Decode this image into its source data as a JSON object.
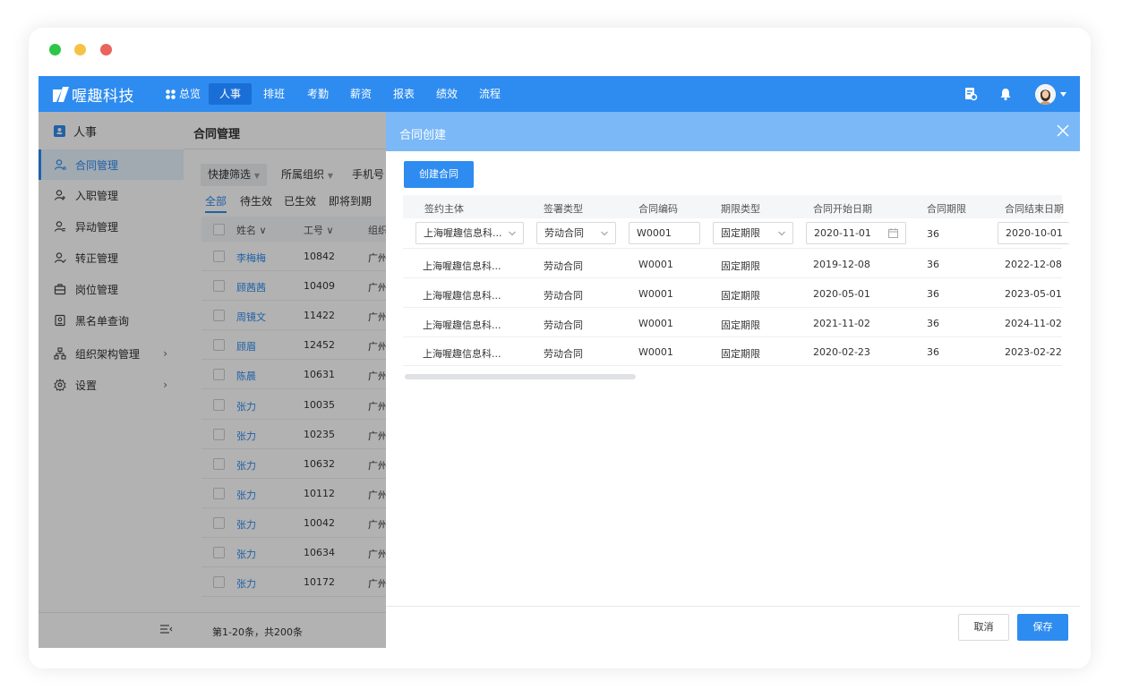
{
  "app": {
    "brand": "喔趣科技",
    "nav": [
      "总览",
      "人事",
      "排班",
      "考勤",
      "薪资",
      "报表",
      "绩效",
      "流程"
    ],
    "active_nav": "人事"
  },
  "sidebar": {
    "title": "人事",
    "items": [
      {
        "label": "合同管理",
        "icon": "person-icon"
      },
      {
        "label": "入职管理",
        "icon": "person-add-icon"
      },
      {
        "label": "异动管理",
        "icon": "person-change-icon"
      },
      {
        "label": "转正管理",
        "icon": "person-check-icon"
      },
      {
        "label": "岗位管理",
        "icon": "briefcase-icon"
      },
      {
        "label": "黑名单查询",
        "icon": "id-card-icon"
      },
      {
        "label": "组织架构管理",
        "icon": "org-tree-icon"
      },
      {
        "label": "设置",
        "icon": "gear-icon"
      }
    ],
    "active_item": "合同管理"
  },
  "list": {
    "title": "合同管理",
    "filters": [
      "快捷筛选",
      "所属组织",
      "手机号"
    ],
    "tabs": [
      "全部",
      "待生效",
      "已生效",
      "即将到期"
    ],
    "columns": [
      "姓名",
      "工号",
      "组织"
    ],
    "rows": [
      {
        "name": "李梅梅",
        "no": "10842",
        "org": "广州"
      },
      {
        "name": "顾茜茜",
        "no": "10409",
        "org": "广州"
      },
      {
        "name": "周镜文",
        "no": "11422",
        "org": "广州"
      },
      {
        "name": "顾眉",
        "no": "12452",
        "org": "广州"
      },
      {
        "name": "陈晨",
        "no": "10631",
        "org": "广州"
      },
      {
        "name": "张力",
        "no": "10035",
        "org": "广州"
      },
      {
        "name": "张力",
        "no": "10235",
        "org": "广州"
      },
      {
        "name": "张力",
        "no": "10632",
        "org": "广州"
      },
      {
        "name": "张力",
        "no": "10112",
        "org": "广州"
      },
      {
        "name": "张力",
        "no": "10042",
        "org": "广州"
      },
      {
        "name": "张力",
        "no": "10634",
        "org": "广州"
      },
      {
        "name": "张力",
        "no": "10172",
        "org": "广州"
      }
    ],
    "pagination": "第1-20条，共200条"
  },
  "drawer": {
    "title": "合同创建",
    "create_button": "创建合同",
    "columns": [
      "签约主体",
      "签署类型",
      "合同编码",
      "期限类型",
      "合同开始日期",
      "合同期限",
      "合同结束日期"
    ],
    "edit_row": {
      "entity": "上海喔趣信息科...",
      "sign_type": "劳动合同",
      "code": "W0001",
      "term_type": "固定期限",
      "start": "2020-11-01",
      "term": "36",
      "end": "2020-10-01"
    },
    "rows": [
      {
        "entity": "上海喔趣信息科...",
        "sign_type": "劳动合同",
        "code": "W0001",
        "term_type": "固定期限",
        "start": "2019-12-08",
        "term": "36",
        "end": "2022-12-08"
      },
      {
        "entity": "上海喔趣信息科...",
        "sign_type": "劳动合同",
        "code": "W0001",
        "term_type": "固定期限",
        "start": "2020-05-01",
        "term": "36",
        "end": "2023-05-01"
      },
      {
        "entity": "上海喔趣信息科...",
        "sign_type": "劳动合同",
        "code": "W0001",
        "term_type": "固定期限",
        "start": "2021-11-02",
        "term": "36",
        "end": "2024-11-02"
      },
      {
        "entity": "上海喔趣信息科...",
        "sign_type": "劳动合同",
        "code": "W0001",
        "term_type": "固定期限",
        "start": "2020-02-23",
        "term": "36",
        "end": "2023-02-22"
      }
    ],
    "cancel_label": "取消",
    "save_label": "保存"
  },
  "colors": {
    "primary": "#2e8cf0",
    "header_light": "#7ab8f7"
  }
}
